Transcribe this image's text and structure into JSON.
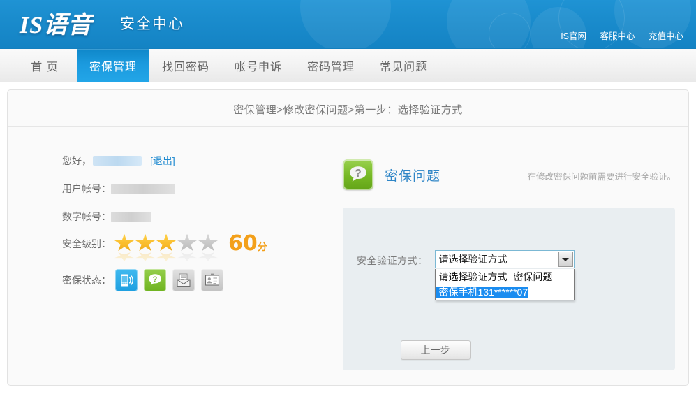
{
  "header": {
    "logo": "IS语音",
    "subtitle": "安全中心",
    "links": [
      {
        "label": "IS官网",
        "name": "link-official-site"
      },
      {
        "label": "客服中心",
        "name": "link-service-center"
      },
      {
        "label": "充值中心",
        "name": "link-recharge-center"
      }
    ]
  },
  "nav": {
    "items": [
      {
        "label": "首 页",
        "active": false
      },
      {
        "label": "密保管理",
        "active": true
      },
      {
        "label": "找回密码",
        "active": false
      },
      {
        "label": "帐号申诉",
        "active": false
      },
      {
        "label": "密码管理",
        "active": false
      },
      {
        "label": "常见问题",
        "active": false
      }
    ]
  },
  "breadcrumb": "密保管理>修改密保问题>第一步：选择验证方式",
  "account": {
    "greeting_label": "您好，",
    "greeting_value_masked": "",
    "logout_label": "[退出]",
    "user_account_label": "用户帐号：",
    "user_account_value_masked": "",
    "digit_account_label": "数字帐号：",
    "digit_account_value_masked": "",
    "security_level_label": "安全级别：",
    "stars_filled": 3,
    "stars_total": 5,
    "score": "60",
    "score_unit": "分",
    "security_status_label": "密保状态：",
    "status_icons": [
      {
        "name": "mobile-phone-icon",
        "state": "active",
        "color": "#1e9fe0"
      },
      {
        "name": "security-question-icon",
        "state": "active",
        "color": "#76b825"
      },
      {
        "name": "email-icon",
        "state": "inactive",
        "color": "#c2c2c2"
      },
      {
        "name": "id-card-icon",
        "state": "inactive",
        "color": "#c2c2c2"
      }
    ]
  },
  "panel": {
    "title": "密保问题",
    "note": "在修改密保问题前需要进行安全验证。",
    "select_label": "安全验证方式：",
    "select_value": "请选择验证方式",
    "options": [
      {
        "label": "请选择验证方式",
        "selected": false
      },
      {
        "label": "密保问题",
        "selected": false
      },
      {
        "label": "密保手机131******07",
        "selected": true
      }
    ],
    "highlight_color": "#1a8cf0"
  },
  "footer": {
    "back_button": "上一步"
  }
}
